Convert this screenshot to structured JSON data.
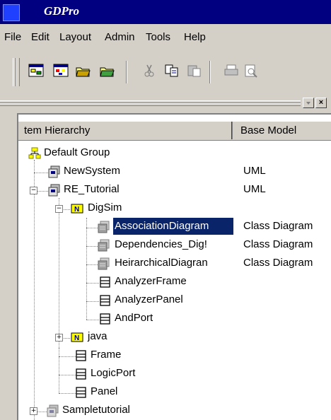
{
  "window": {
    "title": "GDPro"
  },
  "menu": [
    {
      "label": "File"
    },
    {
      "label": "Edit"
    },
    {
      "label": "Layout"
    },
    {
      "label": "Admin"
    },
    {
      "label": "Tools"
    },
    {
      "label": "Help"
    }
  ],
  "toolbar": {
    "buttons": [
      {
        "icon": "new-diagram-icon"
      },
      {
        "icon": "new-palette-icon"
      },
      {
        "icon": "open-icon"
      },
      {
        "icon": "save-icon"
      },
      {
        "icon": "cut-icon"
      },
      {
        "icon": "copy-icon"
      },
      {
        "icon": "paste-icon"
      },
      {
        "icon": "print-icon"
      },
      {
        "icon": "print-preview-icon"
      }
    ]
  },
  "tree": {
    "columns": [
      "tem Hierarchy",
      "Base Model"
    ],
    "rows": [
      {
        "label": "Default Group",
        "model": "",
        "icon": "group-icon"
      },
      {
        "label": "NewSystem",
        "model": "UML",
        "icon": "system-icon"
      },
      {
        "label": "RE_Tutorial",
        "model": "UML",
        "icon": "system-icon"
      },
      {
        "label": "DigSim",
        "model": "",
        "icon": "package-icon"
      },
      {
        "label": "AssociationDiagram",
        "model": "Class Diagram",
        "icon": "diagram-icon",
        "selected": true
      },
      {
        "label": "Dependencies_Dig!",
        "model": "Class Diagram",
        "icon": "diagram-icon"
      },
      {
        "label": "HeirarchicalDiagran",
        "model": "Class Diagram",
        "icon": "diagram-icon"
      },
      {
        "label": "AnalyzerFrame",
        "model": "",
        "icon": "class-icon"
      },
      {
        "label": "AnalyzerPanel",
        "model": "",
        "icon": "class-icon"
      },
      {
        "label": "AndPort",
        "model": "",
        "icon": "class-icon"
      },
      {
        "label": "java",
        "model": "",
        "icon": "package-icon"
      },
      {
        "label": "Frame",
        "model": "",
        "icon": "class-icon"
      },
      {
        "label": "LogicPort",
        "model": "",
        "icon": "class-icon"
      },
      {
        "label": "Panel",
        "model": "",
        "icon": "class-icon"
      },
      {
        "label": "Sampletutorial",
        "model": "",
        "icon": "system-icon"
      }
    ]
  },
  "colors": {
    "titlebar": "#000080",
    "selection": "#0a246a",
    "face": "#d4d0c8",
    "package": "#ffff00"
  }
}
